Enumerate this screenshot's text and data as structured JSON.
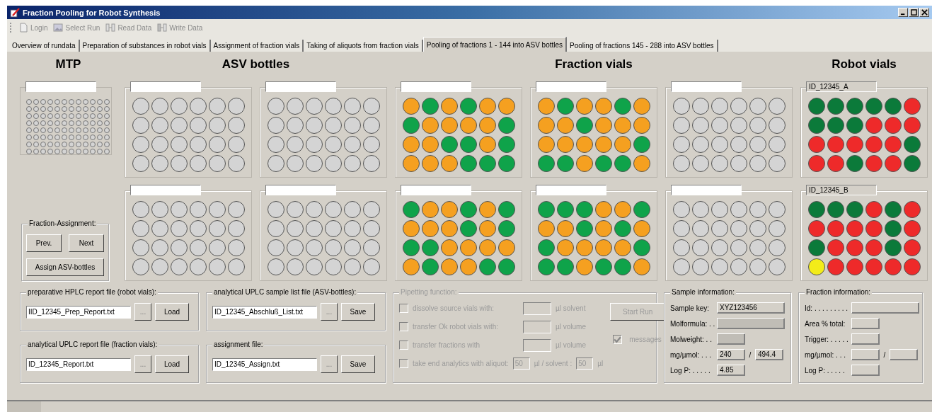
{
  "window": {
    "title": "Fraction Pooling for Robot Synthesis"
  },
  "toolbar": [
    {
      "label": "Login",
      "kind": "login",
      "disabled": true
    },
    {
      "label": "Select Run",
      "kind": "select",
      "disabled": true
    },
    {
      "label": "Read Data",
      "kind": "read",
      "disabled": true
    },
    {
      "label": "Write Data",
      "kind": "write",
      "disabled": true
    }
  ],
  "tabs": [
    {
      "label": "Overview of rundata",
      "selected": false
    },
    {
      "label": "Preparation of substances in robot vials",
      "selected": false
    },
    {
      "label": "Assignment of fraction vials",
      "selected": false
    },
    {
      "label": "Taking of aliquots from fraction vials",
      "selected": false
    },
    {
      "label": "Pooling of fractions 1 - 144 into ASV bottles",
      "selected": true
    },
    {
      "label": "Pooling of fractions 145 - 288 into ASV bottles",
      "selected": false
    }
  ],
  "headings": {
    "mtp": "MTP",
    "asv": "ASV bottles",
    "fraction": "Fraction vials",
    "robot": "Robot vials"
  },
  "plate_rows": [
    [
      {
        "wells": [
          [
            {
              "color": "#d4d4d4"
            },
            {
              "color": "#d4d4d4"
            },
            {
              "color": "#d4d4d4"
            },
            {
              "color": "#d4d4d4"
            },
            {
              "color": "#d4d4d4"
            },
            {
              "color": "#d4d4d4"
            }
          ],
          [
            {
              "color": "#d4d4d4"
            },
            {
              "color": "#d4d4d4"
            },
            {
              "color": "#d4d4d4"
            },
            {
              "color": "#d4d4d4"
            },
            {
              "color": "#d4d4d4"
            },
            {
              "color": "#d4d4d4"
            }
          ],
          [
            {
              "color": "#d4d4d4"
            },
            {
              "color": "#d4d4d4"
            },
            {
              "color": "#d4d4d4"
            },
            {
              "color": "#d4d4d4"
            },
            {
              "color": "#d4d4d4"
            },
            {
              "color": "#d4d4d4"
            }
          ],
          [
            {
              "color": "#d4d4d4"
            },
            {
              "color": "#d4d4d4"
            },
            {
              "color": "#d4d4d4"
            },
            {
              "color": "#d4d4d4"
            },
            {
              "color": "#d4d4d4"
            },
            {
              "color": "#d4d4d4"
            }
          ]
        ]
      },
      {
        "wells": [
          [
            {
              "color": "#d4d4d4"
            },
            {
              "color": "#d4d4d4"
            },
            {
              "color": "#d4d4d4"
            },
            {
              "color": "#d4d4d4"
            },
            {
              "color": "#d4d4d4"
            },
            {
              "color": "#d4d4d4"
            }
          ],
          [
            {
              "color": "#d4d4d4"
            },
            {
              "color": "#d4d4d4"
            },
            {
              "color": "#d4d4d4"
            },
            {
              "color": "#d4d4d4"
            },
            {
              "color": "#d4d4d4"
            },
            {
              "color": "#d4d4d4"
            }
          ],
          [
            {
              "color": "#d4d4d4"
            },
            {
              "color": "#d4d4d4"
            },
            {
              "color": "#d4d4d4"
            },
            {
              "color": "#d4d4d4"
            },
            {
              "color": "#d4d4d4"
            },
            {
              "color": "#d4d4d4"
            }
          ],
          [
            {
              "color": "#d4d4d4"
            },
            {
              "color": "#d4d4d4"
            },
            {
              "color": "#d4d4d4"
            },
            {
              "color": "#d4d4d4"
            },
            {
              "color": "#d4d4d4"
            },
            {
              "color": "#d4d4d4"
            }
          ]
        ]
      },
      {
        "wells": [
          [
            {
              "color": "#f5a020"
            },
            {
              "color": "#0fa34a"
            },
            {
              "color": "#f5a020"
            },
            {
              "color": "#0fa34a"
            },
            {
              "color": "#f5a020"
            },
            {
              "color": "#f5a020"
            }
          ],
          [
            {
              "color": "#0fa34a"
            },
            {
              "color": "#f5a020"
            },
            {
              "color": "#f5a020"
            },
            {
              "color": "#f5a020"
            },
            {
              "color": "#f5a020"
            },
            {
              "color": "#0fa34a"
            }
          ],
          [
            {
              "color": "#f5a020"
            },
            {
              "color": "#f5a020"
            },
            {
              "color": "#0fa34a"
            },
            {
              "color": "#0fa34a"
            },
            {
              "color": "#f5a020"
            },
            {
              "color": "#0fa34a"
            }
          ],
          [
            {
              "color": "#f5a020"
            },
            {
              "color": "#f5a020"
            },
            {
              "color": "#f5a020"
            },
            {
              "color": "#0fa34a"
            },
            {
              "color": "#0fa34a"
            },
            {
              "color": "#0fa34a"
            }
          ]
        ]
      },
      {
        "wells": [
          [
            {
              "color": "#f5a020"
            },
            {
              "color": "#0fa34a"
            },
            {
              "color": "#f5a020"
            },
            {
              "color": "#f5a020"
            },
            {
              "color": "#0fa34a"
            },
            {
              "color": "#f5a020"
            }
          ],
          [
            {
              "color": "#f5a020"
            },
            {
              "color": "#f5a020"
            },
            {
              "color": "#0fa34a"
            },
            {
              "color": "#f5a020"
            },
            {
              "color": "#f5a020"
            },
            {
              "color": "#f5a020"
            }
          ],
          [
            {
              "color": "#f5a020"
            },
            {
              "color": "#f5a020"
            },
            {
              "color": "#f5a020"
            },
            {
              "color": "#f5a020"
            },
            {
              "color": "#f5a020"
            },
            {
              "color": "#0fa34a"
            }
          ],
          [
            {
              "color": "#0fa34a"
            },
            {
              "color": "#0fa34a"
            },
            {
              "color": "#f5a020"
            },
            {
              "color": "#0fa34a"
            },
            {
              "color": "#0fa34a"
            },
            {
              "color": "#f5a020"
            }
          ]
        ]
      },
      {
        "wells": [
          [
            {
              "color": "#d4d4d4"
            },
            {
              "color": "#d4d4d4"
            },
            {
              "color": "#d4d4d4"
            },
            {
              "color": "#d4d4d4"
            },
            {
              "color": "#d4d4d4"
            },
            {
              "color": "#d4d4d4"
            }
          ],
          [
            {
              "color": "#d4d4d4"
            },
            {
              "color": "#d4d4d4"
            },
            {
              "color": "#d4d4d4"
            },
            {
              "color": "#d4d4d4"
            },
            {
              "color": "#d4d4d4"
            },
            {
              "color": "#d4d4d4"
            }
          ],
          [
            {
              "color": "#d4d4d4"
            },
            {
              "color": "#d4d4d4"
            },
            {
              "color": "#d4d4d4"
            },
            {
              "color": "#d4d4d4"
            },
            {
              "color": "#d4d4d4"
            },
            {
              "color": "#d4d4d4"
            }
          ],
          [
            {
              "color": "#d4d4d4"
            },
            {
              "color": "#d4d4d4"
            },
            {
              "color": "#d4d4d4"
            },
            {
              "color": "#d4d4d4"
            },
            {
              "color": "#d4d4d4"
            },
            {
              "color": "#d4d4d4"
            }
          ]
        ]
      },
      {
        "label": "ID_12345_A",
        "wells": [
          [
            {
              "color": "#0b7a3a"
            },
            {
              "color": "#0b7a3a"
            },
            {
              "color": "#0b7a3a"
            },
            {
              "color": "#0b7a3a"
            },
            {
              "color": "#0b7a3a"
            },
            {
              "color": "#ee2a2a"
            }
          ],
          [
            {
              "color": "#0b7a3a"
            },
            {
              "color": "#0b7a3a"
            },
            {
              "color": "#0b7a3a"
            },
            {
              "color": "#ee2a2a"
            },
            {
              "color": "#ee2a2a"
            },
            {
              "color": "#ee2a2a"
            }
          ],
          [
            {
              "color": "#ee2a2a"
            },
            {
              "color": "#ee2a2a"
            },
            {
              "color": "#ee2a2a"
            },
            {
              "color": "#ee2a2a"
            },
            {
              "color": "#ee2a2a"
            },
            {
              "color": "#0b7a3a"
            }
          ],
          [
            {
              "color": "#ee2a2a"
            },
            {
              "color": "#ee2a2a"
            },
            {
              "color": "#0b7a3a"
            },
            {
              "color": "#ee2a2a"
            },
            {
              "color": "#ee2a2a"
            },
            {
              "color": "#0b7a3a"
            }
          ]
        ]
      }
    ],
    [
      {
        "wells": [
          [
            {
              "color": "#d4d4d4"
            },
            {
              "color": "#d4d4d4"
            },
            {
              "color": "#d4d4d4"
            },
            {
              "color": "#d4d4d4"
            },
            {
              "color": "#d4d4d4"
            },
            {
              "color": "#d4d4d4"
            }
          ],
          [
            {
              "color": "#d4d4d4"
            },
            {
              "color": "#d4d4d4"
            },
            {
              "color": "#d4d4d4"
            },
            {
              "color": "#d4d4d4"
            },
            {
              "color": "#d4d4d4"
            },
            {
              "color": "#d4d4d4"
            }
          ],
          [
            {
              "color": "#d4d4d4"
            },
            {
              "color": "#d4d4d4"
            },
            {
              "color": "#d4d4d4"
            },
            {
              "color": "#d4d4d4"
            },
            {
              "color": "#d4d4d4"
            },
            {
              "color": "#d4d4d4"
            }
          ],
          [
            {
              "color": "#d4d4d4"
            },
            {
              "color": "#d4d4d4"
            },
            {
              "color": "#d4d4d4"
            },
            {
              "color": "#d4d4d4"
            },
            {
              "color": "#d4d4d4"
            },
            {
              "color": "#d4d4d4"
            }
          ]
        ]
      },
      {
        "wells": [
          [
            {
              "color": "#d4d4d4"
            },
            {
              "color": "#d4d4d4"
            },
            {
              "color": "#d4d4d4"
            },
            {
              "color": "#d4d4d4"
            },
            {
              "color": "#d4d4d4"
            },
            {
              "color": "#d4d4d4"
            }
          ],
          [
            {
              "color": "#d4d4d4"
            },
            {
              "color": "#d4d4d4"
            },
            {
              "color": "#d4d4d4"
            },
            {
              "color": "#d4d4d4"
            },
            {
              "color": "#d4d4d4"
            },
            {
              "color": "#d4d4d4"
            }
          ],
          [
            {
              "color": "#d4d4d4"
            },
            {
              "color": "#d4d4d4"
            },
            {
              "color": "#d4d4d4"
            },
            {
              "color": "#d4d4d4"
            },
            {
              "color": "#d4d4d4"
            },
            {
              "color": "#d4d4d4"
            }
          ],
          [
            {
              "color": "#d4d4d4"
            },
            {
              "color": "#d4d4d4"
            },
            {
              "color": "#d4d4d4"
            },
            {
              "color": "#d4d4d4"
            },
            {
              "color": "#d4d4d4"
            },
            {
              "color": "#d4d4d4"
            }
          ]
        ]
      },
      {
        "wells": [
          [
            {
              "color": "#0fa34a"
            },
            {
              "color": "#f5a020"
            },
            {
              "color": "#f5a020"
            },
            {
              "color": "#0fa34a"
            },
            {
              "color": "#f5a020"
            },
            {
              "color": "#0fa34a"
            }
          ],
          [
            {
              "color": "#f5a020"
            },
            {
              "color": "#f5a020"
            },
            {
              "color": "#f5a020"
            },
            {
              "color": "#0fa34a"
            },
            {
              "color": "#f5a020"
            },
            {
              "color": "#0fa34a"
            }
          ],
          [
            {
              "color": "#0fa34a"
            },
            {
              "color": "#0fa34a"
            },
            {
              "color": "#f5a020"
            },
            {
              "color": "#f5a020"
            },
            {
              "color": "#f5a020"
            },
            {
              "color": "#f5a020"
            }
          ],
          [
            {
              "color": "#f5a020"
            },
            {
              "color": "#0fa34a"
            },
            {
              "color": "#f5a020"
            },
            {
              "color": "#f5a020"
            },
            {
              "color": "#0fa34a"
            },
            {
              "color": "#0fa34a"
            }
          ]
        ]
      },
      {
        "wells": [
          [
            {
              "color": "#0fa34a"
            },
            {
              "color": "#0fa34a"
            },
            {
              "color": "#0fa34a"
            },
            {
              "color": "#f5a020"
            },
            {
              "color": "#f5a020"
            },
            {
              "color": "#0fa34a"
            }
          ],
          [
            {
              "color": "#f5a020"
            },
            {
              "color": "#f5a020"
            },
            {
              "color": "#0fa34a"
            },
            {
              "color": "#f5a020"
            },
            {
              "color": "#0fa34a"
            },
            {
              "color": "#f5a020"
            }
          ],
          [
            {
              "color": "#0fa34a"
            },
            {
              "color": "#f5a020"
            },
            {
              "color": "#f5a020"
            },
            {
              "color": "#f5a020"
            },
            {
              "color": "#f5a020"
            },
            {
              "color": "#0fa34a"
            }
          ],
          [
            {
              "color": "#0fa34a"
            },
            {
              "color": "#0fa34a"
            },
            {
              "color": "#f5a020"
            },
            {
              "color": "#0fa34a"
            },
            {
              "color": "#0fa34a"
            },
            {
              "color": "#f5a020"
            }
          ]
        ]
      },
      {
        "wells": [
          [
            {
              "color": "#d4d4d4"
            },
            {
              "color": "#d4d4d4"
            },
            {
              "color": "#d4d4d4"
            },
            {
              "color": "#d4d4d4"
            },
            {
              "color": "#d4d4d4"
            },
            {
              "color": "#d4d4d4"
            }
          ],
          [
            {
              "color": "#d4d4d4"
            },
            {
              "color": "#d4d4d4"
            },
            {
              "color": "#d4d4d4"
            },
            {
              "color": "#d4d4d4"
            },
            {
              "color": "#d4d4d4"
            },
            {
              "color": "#d4d4d4"
            }
          ],
          [
            {
              "color": "#d4d4d4"
            },
            {
              "color": "#d4d4d4"
            },
            {
              "color": "#d4d4d4"
            },
            {
              "color": "#d4d4d4"
            },
            {
              "color": "#d4d4d4"
            },
            {
              "color": "#d4d4d4"
            }
          ],
          [
            {
              "color": "#d4d4d4"
            },
            {
              "color": "#d4d4d4"
            },
            {
              "color": "#d4d4d4"
            },
            {
              "color": "#d4d4d4"
            },
            {
              "color": "#d4d4d4"
            },
            {
              "color": "#d4d4d4"
            }
          ]
        ]
      },
      {
        "label": "ID_12345_B",
        "wells": [
          [
            {
              "color": "#0b7a3a"
            },
            {
              "color": "#0b7a3a"
            },
            {
              "color": "#0b7a3a"
            },
            {
              "color": "#ee2a2a"
            },
            {
              "color": "#0b7a3a"
            },
            {
              "color": "#ee2a2a"
            }
          ],
          [
            {
              "color": "#ee2a2a"
            },
            {
              "color": "#ee2a2a"
            },
            {
              "color": "#ee2a2a"
            },
            {
              "color": "#ee2a2a"
            },
            {
              "color": "#0b7a3a"
            },
            {
              "color": "#ee2a2a"
            }
          ],
          [
            {
              "color": "#0b7a3a"
            },
            {
              "color": "#ee2a2a"
            },
            {
              "color": "#ee2a2a"
            },
            {
              "color": "#ee2a2a"
            },
            {
              "color": "#0b7a3a"
            },
            {
              "color": "#ee2a2a"
            }
          ],
          [
            {
              "color": "#f3ec19"
            },
            {
              "color": "#ee2a2a"
            },
            {
              "color": "#ee2a2a"
            },
            {
              "color": "#ee2a2a"
            },
            {
              "color": "#ee2a2a"
            },
            {
              "color": "#ee2a2a"
            }
          ]
        ]
      }
    ]
  ],
  "fraction_assignment": {
    "title": "Fraction-Assignment:",
    "prev": "Prev.",
    "next": "Next",
    "assign": "Assign ASV-bottles"
  },
  "file_groups": [
    {
      "title": "preparative HPLC report file (robot vials):",
      "value": "IID_12345_Prep_Report.txt",
      "browse": "...",
      "action": "Load"
    },
    {
      "title": "analytical UPLC sample list file (ASV-bottles):",
      "value": "ID_12345_Abschluß_List.txt",
      "browse": "...",
      "action": "Save"
    },
    {
      "title": "analytical UPLC report file (fraction vials):",
      "value": "ID_12345_Report.txt",
      "browse": "...",
      "action": "Load"
    },
    {
      "title": "assignment file:",
      "value": "ID_12345_Assign.txt",
      "browse": "...",
      "action": "Save"
    }
  ],
  "pipetting": {
    "title": "Pipetting function:",
    "disabled": true,
    "start": "Start Run",
    "messages": {
      "label": "messages",
      "checked": true
    },
    "rows": [
      {
        "kind": "volume",
        "checked": false,
        "label": "dissolve source vials  with:",
        "unit": "µl solvent"
      },
      {
        "kind": "volume",
        "checked": false,
        "label": "transfer Ok robot vials with:",
        "unit": "µl volume"
      },
      {
        "kind": "volume",
        "checked": false,
        "label": "transfer fractions with",
        "unit": "µl volume"
      },
      {
        "kind": "aliquot",
        "checked": false,
        "label": "take end analytics with aliquot:",
        "value": "50",
        "mid": "µl / solvent :",
        "value2": "50",
        "unit": "µl"
      }
    ]
  },
  "sample_info": {
    "title": "Sample information:",
    "fields": [
      {
        "label": "Sample key:",
        "kind": "wide",
        "shaded": false,
        "value": "XYZ123456"
      },
      {
        "label": "Molformula: . .",
        "kind": "wide",
        "shaded": true
      },
      {
        "label": "Molweight: . .",
        "kind": "narrow",
        "shaded": true
      },
      {
        "label": "mg/µmol: . . .",
        "kind": "pair",
        "shaded": false,
        "value": "240",
        "separator": "/",
        "value2": "494.4"
      },
      {
        "label": "Log P: . . . . .",
        "kind": "narrow",
        "shaded": false,
        "value": "4.85"
      }
    ]
  },
  "fraction_info": {
    "title": "Fraction information:",
    "fields": [
      {
        "label": "Id: . . . . . . . . .",
        "kind": "wide",
        "shaded": false
      },
      {
        "label": "Area % total:",
        "kind": "narrow",
        "shaded": false
      },
      {
        "label": "Trigger: . . . . .",
        "kind": "narrow",
        "shaded": false
      },
      {
        "label": "mg/µmol: . . .",
        "kind": "pair",
        "shaded": false,
        "separator": "/"
      },
      {
        "label": "Log P: . . . . .",
        "kind": "narrow",
        "shaded": false
      }
    ]
  }
}
